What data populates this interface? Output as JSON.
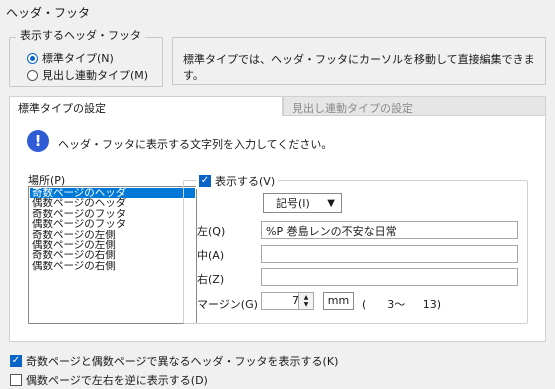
{
  "window": {
    "title": "ヘッダ・フッタ"
  },
  "display_group": {
    "legend": "表示するヘッダ・フッタ",
    "options": [
      {
        "label": "標準タイプ(N)",
        "selected": true
      },
      {
        "label": "見出し連動タイプ(M)",
        "selected": false
      }
    ]
  },
  "description": "標準タイプでは、ヘッダ・フッタにカーソルを移動して直接編集できます。",
  "tabs": [
    {
      "label": "標準タイプの設定",
      "active": true
    },
    {
      "label": "見出し連動タイプの設定",
      "active": false
    }
  ],
  "info_message": "ヘッダ・フッタに表示する文字列を入力してください。",
  "location": {
    "label": "場所(P)",
    "items": [
      "奇数ページのヘッダ",
      "偶数ページのヘッダ",
      "奇数ページのフッタ",
      "偶数ページのフッタ",
      "奇数ページの左側",
      "偶数ページの左側",
      "奇数ページの右側",
      "偶数ページの右側"
    ],
    "selected_index": 0
  },
  "show_checkbox": {
    "label": "表示する(V)",
    "checked": true
  },
  "symbol_combo": {
    "label": "記号(I)"
  },
  "fields": {
    "left": {
      "label": "左(Q)",
      "value": "%P  巻島レンの不安な日常"
    },
    "center": {
      "label": "中(A)",
      "value": ""
    },
    "right": {
      "label": "右(Z)",
      "value": ""
    }
  },
  "margin": {
    "label": "マージン(G)",
    "value": "7",
    "unit": "mm",
    "range": "(      3～     13)"
  },
  "bottom_checkboxes": [
    {
      "label": "奇数ページと偶数ページで異なるヘッダ・フッタを表示する(K)",
      "checked": true
    },
    {
      "label": "偶数ページで左右を逆に表示する(D)",
      "checked": false
    }
  ],
  "colors": {
    "accent": "#0a64c8",
    "selection": "#0078d7",
    "info_icon": "#2f5bd6"
  }
}
